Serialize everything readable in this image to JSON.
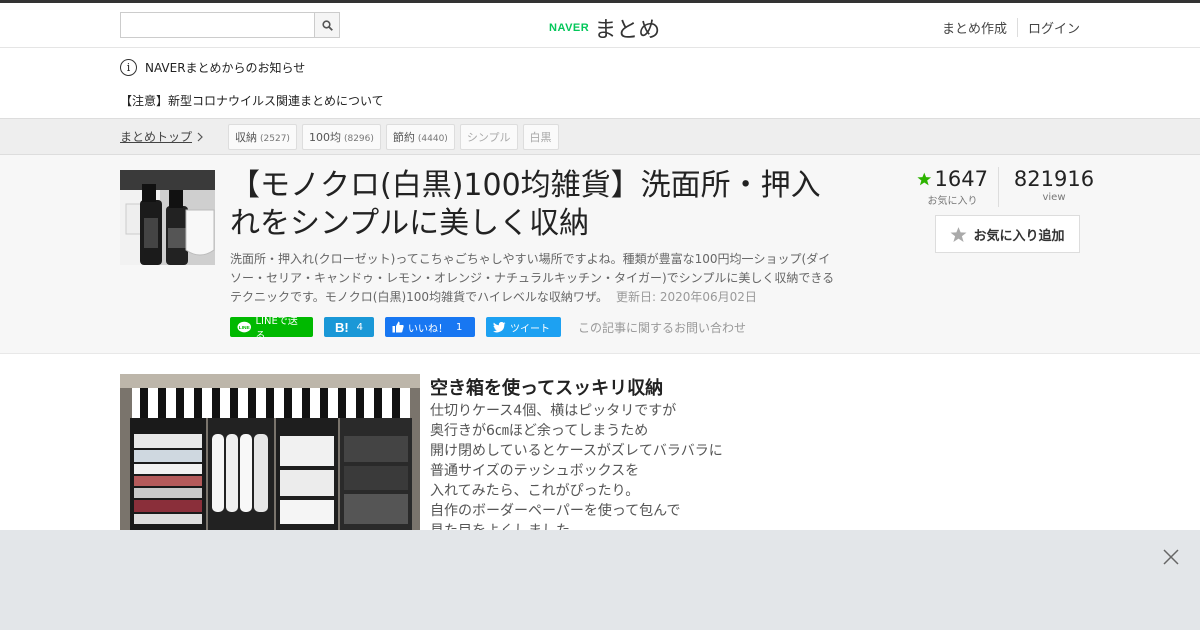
{
  "header": {
    "search_placeholder": "",
    "logo_brand": "NAVER",
    "logo_text": "まとめ",
    "nav": [
      "まとめ作成",
      "ログイン"
    ]
  },
  "notice": {
    "title": "NAVERまとめからのお知らせ",
    "item": "【注意】新型コロナウイルス関連まとめについて"
  },
  "breadcrumb": {
    "top": "まとめトップ",
    "tags": [
      {
        "label": "収納",
        "count": "(2527)"
      },
      {
        "label": "100均",
        "count": "(8296)"
      },
      {
        "label": "節約",
        "count": "(4440)"
      },
      {
        "label": "シンプル",
        "count": ""
      },
      {
        "label": "白黒",
        "count": ""
      }
    ]
  },
  "article": {
    "title": "【モノクロ(白黒)100均雑貨】洗面所・押入れをシンプルに美しく収納",
    "description": "洗面所・押入れ(クローゼット)ってこちゃごちゃしやすい場所ですよね。種類が豊富な100円均一ショップ(ダイソー・セリア・キャンドゥ・レモン・オレンジ・ナチュラルキッチン・タイガー)でシンプルに美しく収納できるテクニックです。モノクロ(白黒)100均雑貨でハイレベルな収納ワザ。",
    "updated": "更新日: 2020年06月02日",
    "favorites": "1647",
    "favorites_label": "お気に入り",
    "views": "821916",
    "views_label": "view",
    "fav_button": "お気に入り追加"
  },
  "share": {
    "line": "LINEで送る",
    "hatena_count": "4",
    "facebook": "いいね！",
    "facebook_count": "1",
    "tweet": "ツイート",
    "contact": "この記事に関するお問い合わせ"
  },
  "content": {
    "item_title": "空き箱を使ってスッキリ収納",
    "lines": [
      "仕切りケース4個、横はピッタリですが",
      "奥行きが6㎝ほど余ってしまうため",
      "開け閉めしているとケースがズレてバラバラに",
      "普通サイズのテッシュボックスを",
      "入れてみたら、これがぴったり。",
      "自作のボーダーペーパーを使って包んで",
      "見た目をよくしました。"
    ]
  },
  "colors": {
    "brand": "#03c75a",
    "star": "#2db400",
    "line": "#00b900",
    "hatena": "#1a98d7",
    "facebook": "#1877f2",
    "twitter": "#1da1f2"
  }
}
